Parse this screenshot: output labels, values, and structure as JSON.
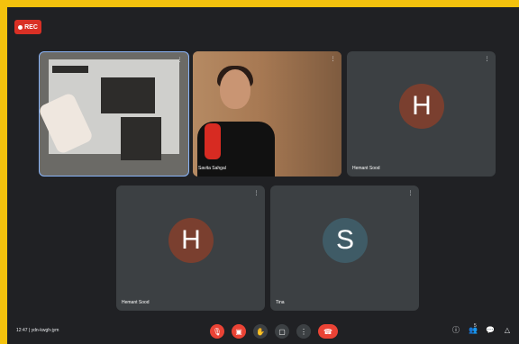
{
  "recording": {
    "label": "REC"
  },
  "tiles": [
    {
      "name": ""
    },
    {
      "name": "Savita Sahgal"
    },
    {
      "name": "Hemant Sood",
      "initial": "H"
    },
    {
      "name": "Hemant Sood",
      "initial": "H"
    },
    {
      "name": "Tina",
      "initial": "S"
    }
  ],
  "bottom": {
    "time": "12:47",
    "meeting_code": "ydn-kwgh-jym"
  },
  "colors": {
    "frame": "#f4c20d",
    "background": "#202124",
    "tile": "#3c4043",
    "red": "#ea4335",
    "avatar_h": "#7a3f2f",
    "avatar_s": "#3f5b66"
  },
  "icons": {
    "mic": "mic-off-icon",
    "camera": "camera-off-icon",
    "hand": "raise-hand-icon",
    "present": "present-icon",
    "more": "more-icon",
    "end": "end-call-icon",
    "info": "info-icon",
    "people": "people-icon",
    "chat": "chat-icon",
    "activities": "activities-icon"
  },
  "people_count": "5"
}
